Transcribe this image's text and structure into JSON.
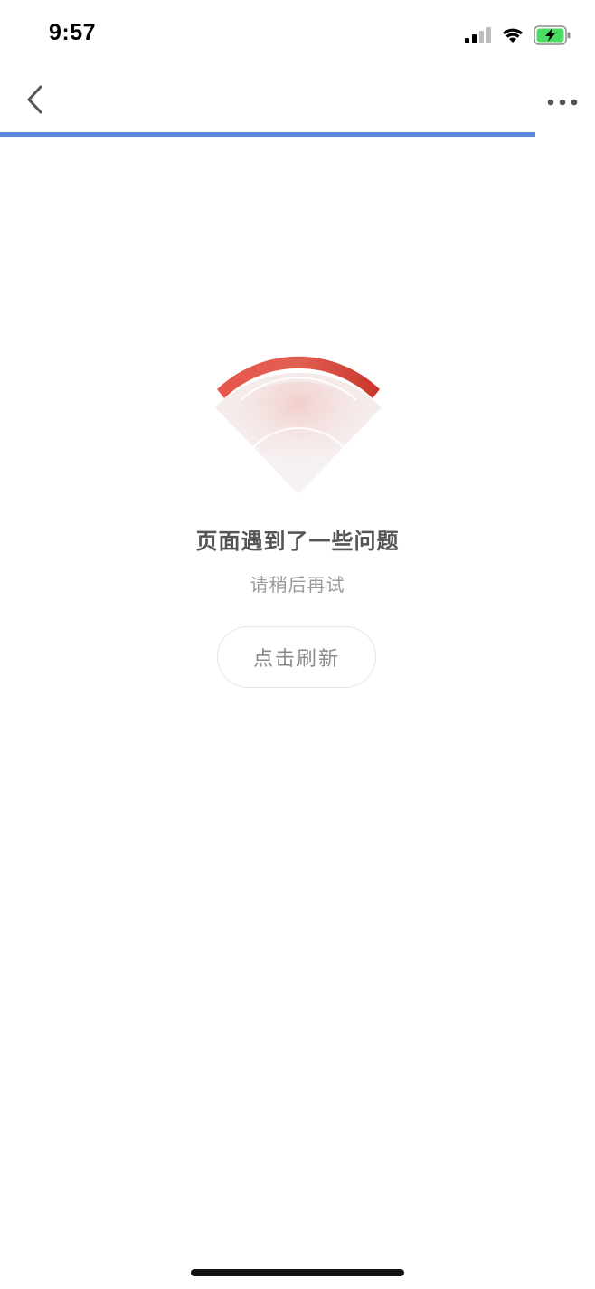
{
  "status_bar": {
    "time": "9:57",
    "icons": [
      "cellular-signal-icon",
      "wifi-icon",
      "battery-charging-icon"
    ],
    "battery_color": "#4cd964"
  },
  "nav": {
    "back_icon": "chevron-left-icon",
    "more_icon": "more-horizontal-icon",
    "progress_fraction": 0.9,
    "progress_color": "#5b87de"
  },
  "error": {
    "illustration": "no-signal-wifi-icon",
    "accent_color": "#d9433b",
    "title": "页面遇到了一些问题",
    "subtitle": "请稍后再试",
    "refresh_label": "点击刷新"
  }
}
